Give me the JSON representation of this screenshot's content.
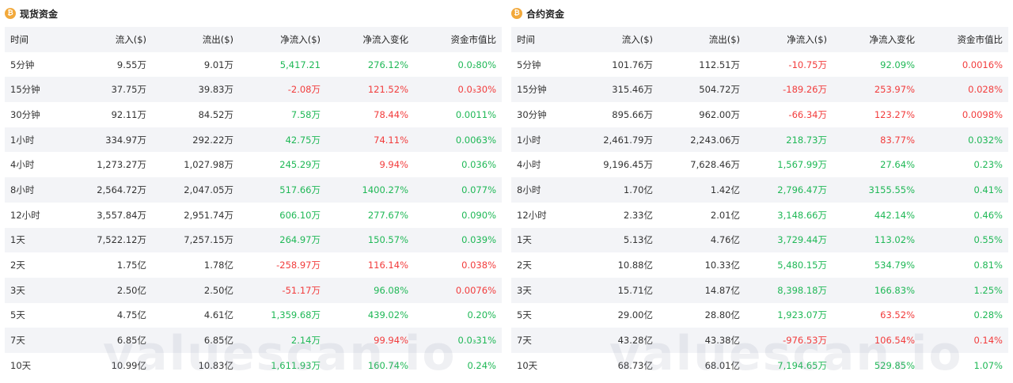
{
  "colors": {
    "positive": "#1fb856",
    "negative": "#f23c3c",
    "accent": "#f2a93b",
    "stripe": "#f3f4f7"
  },
  "watermark": "valuescan.io",
  "spot": {
    "title": "现货资金",
    "icon": "coin-icon",
    "columns": [
      "时间",
      "流入($)",
      "流出($)",
      "净流入($)",
      "净流入变化",
      "资金市值比"
    ],
    "rows": [
      {
        "time": "5分钟",
        "inflow": "9.55万",
        "outflow": "9.01万",
        "net": "5,417.21",
        "net_sign": "pos",
        "change": "276.12%",
        "change_sign": "pos",
        "ratio": "0.0₂80%",
        "ratio_sign": "pos"
      },
      {
        "time": "15分钟",
        "inflow": "37.75万",
        "outflow": "39.83万",
        "net": "-2.08万",
        "net_sign": "neg",
        "change": "121.52%",
        "change_sign": "neg",
        "ratio": "0.0₃30%",
        "ratio_sign": "neg"
      },
      {
        "time": "30分钟",
        "inflow": "92.11万",
        "outflow": "84.52万",
        "net": "7.58万",
        "net_sign": "pos",
        "change": "78.44%",
        "change_sign": "neg",
        "ratio": "0.0011%",
        "ratio_sign": "pos"
      },
      {
        "time": "1小时",
        "inflow": "334.97万",
        "outflow": "292.22万",
        "net": "42.75万",
        "net_sign": "pos",
        "change": "74.11%",
        "change_sign": "neg",
        "ratio": "0.0063%",
        "ratio_sign": "pos"
      },
      {
        "time": "4小时",
        "inflow": "1,273.27万",
        "outflow": "1,027.98万",
        "net": "245.29万",
        "net_sign": "pos",
        "change": "9.94%",
        "change_sign": "neg",
        "ratio": "0.036%",
        "ratio_sign": "pos"
      },
      {
        "time": "8小时",
        "inflow": "2,564.72万",
        "outflow": "2,047.05万",
        "net": "517.66万",
        "net_sign": "pos",
        "change": "1400.27%",
        "change_sign": "pos",
        "ratio": "0.077%",
        "ratio_sign": "pos"
      },
      {
        "time": "12小时",
        "inflow": "3,557.84万",
        "outflow": "2,951.74万",
        "net": "606.10万",
        "net_sign": "pos",
        "change": "277.67%",
        "change_sign": "pos",
        "ratio": "0.090%",
        "ratio_sign": "pos"
      },
      {
        "time": "1天",
        "inflow": "7,522.12万",
        "outflow": "7,257.15万",
        "net": "264.97万",
        "net_sign": "pos",
        "change": "150.57%",
        "change_sign": "pos",
        "ratio": "0.039%",
        "ratio_sign": "pos"
      },
      {
        "time": "2天",
        "inflow": "1.75亿",
        "outflow": "1.78亿",
        "net": "-258.97万",
        "net_sign": "neg",
        "change": "116.14%",
        "change_sign": "neg",
        "ratio": "0.038%",
        "ratio_sign": "neg"
      },
      {
        "time": "3天",
        "inflow": "2.50亿",
        "outflow": "2.50亿",
        "net": "-51.17万",
        "net_sign": "neg",
        "change": "96.08%",
        "change_sign": "pos",
        "ratio": "0.0076%",
        "ratio_sign": "neg"
      },
      {
        "time": "5天",
        "inflow": "4.75亿",
        "outflow": "4.61亿",
        "net": "1,359.68万",
        "net_sign": "pos",
        "change": "439.02%",
        "change_sign": "pos",
        "ratio": "0.20%",
        "ratio_sign": "pos"
      },
      {
        "time": "7天",
        "inflow": "6.85亿",
        "outflow": "6.85亿",
        "net": "2.14万",
        "net_sign": "pos",
        "change": "99.94%",
        "change_sign": "neg",
        "ratio": "0.0₃31%",
        "ratio_sign": "pos"
      },
      {
        "time": "10天",
        "inflow": "10.99亿",
        "outflow": "10.83亿",
        "net": "1,611.93万",
        "net_sign": "pos",
        "change": "160.74%",
        "change_sign": "pos",
        "ratio": "0.24%",
        "ratio_sign": "pos"
      }
    ]
  },
  "futures": {
    "title": "合约资金",
    "icon": "coin-icon",
    "columns": [
      "时间",
      "流入($)",
      "流出($)",
      "净流入($)",
      "净流入变化",
      "资金市值比"
    ],
    "rows": [
      {
        "time": "5分钟",
        "inflow": "101.76万",
        "outflow": "112.51万",
        "net": "-10.75万",
        "net_sign": "neg",
        "change": "92.09%",
        "change_sign": "pos",
        "ratio": "0.0016%",
        "ratio_sign": "neg"
      },
      {
        "time": "15分钟",
        "inflow": "315.46万",
        "outflow": "504.72万",
        "net": "-189.26万",
        "net_sign": "neg",
        "change": "253.97%",
        "change_sign": "neg",
        "ratio": "0.028%",
        "ratio_sign": "neg"
      },
      {
        "time": "30分钟",
        "inflow": "895.66万",
        "outflow": "962.00万",
        "net": "-66.34万",
        "net_sign": "neg",
        "change": "123.27%",
        "change_sign": "neg",
        "ratio": "0.0098%",
        "ratio_sign": "neg"
      },
      {
        "time": "1小时",
        "inflow": "2,461.79万",
        "outflow": "2,243.06万",
        "net": "218.73万",
        "net_sign": "pos",
        "change": "83.77%",
        "change_sign": "neg",
        "ratio": "0.032%",
        "ratio_sign": "pos"
      },
      {
        "time": "4小时",
        "inflow": "9,196.45万",
        "outflow": "7,628.46万",
        "net": "1,567.99万",
        "net_sign": "pos",
        "change": "27.64%",
        "change_sign": "pos",
        "ratio": "0.23%",
        "ratio_sign": "pos"
      },
      {
        "time": "8小时",
        "inflow": "1.70亿",
        "outflow": "1.42亿",
        "net": "2,796.47万",
        "net_sign": "pos",
        "change": "3155.55%",
        "change_sign": "pos",
        "ratio": "0.41%",
        "ratio_sign": "pos"
      },
      {
        "time": "12小时",
        "inflow": "2.33亿",
        "outflow": "2.01亿",
        "net": "3,148.66万",
        "net_sign": "pos",
        "change": "442.14%",
        "change_sign": "pos",
        "ratio": "0.46%",
        "ratio_sign": "pos"
      },
      {
        "time": "1天",
        "inflow": "5.13亿",
        "outflow": "4.76亿",
        "net": "3,729.44万",
        "net_sign": "pos",
        "change": "113.02%",
        "change_sign": "pos",
        "ratio": "0.55%",
        "ratio_sign": "pos"
      },
      {
        "time": "2天",
        "inflow": "10.88亿",
        "outflow": "10.33亿",
        "net": "5,480.15万",
        "net_sign": "pos",
        "change": "534.79%",
        "change_sign": "pos",
        "ratio": "0.81%",
        "ratio_sign": "pos"
      },
      {
        "time": "3天",
        "inflow": "15.71亿",
        "outflow": "14.87亿",
        "net": "8,398.18万",
        "net_sign": "pos",
        "change": "166.83%",
        "change_sign": "pos",
        "ratio": "1.25%",
        "ratio_sign": "pos"
      },
      {
        "time": "5天",
        "inflow": "29.00亿",
        "outflow": "28.80亿",
        "net": "1,923.07万",
        "net_sign": "pos",
        "change": "63.52%",
        "change_sign": "neg",
        "ratio": "0.28%",
        "ratio_sign": "pos"
      },
      {
        "time": "7天",
        "inflow": "43.28亿",
        "outflow": "43.38亿",
        "net": "-976.53万",
        "net_sign": "neg",
        "change": "106.54%",
        "change_sign": "neg",
        "ratio": "0.14%",
        "ratio_sign": "neg"
      },
      {
        "time": "10天",
        "inflow": "68.73亿",
        "outflow": "68.01亿",
        "net": "7,194.65万",
        "net_sign": "pos",
        "change": "529.85%",
        "change_sign": "pos",
        "ratio": "1.07%",
        "ratio_sign": "pos"
      }
    ]
  }
}
